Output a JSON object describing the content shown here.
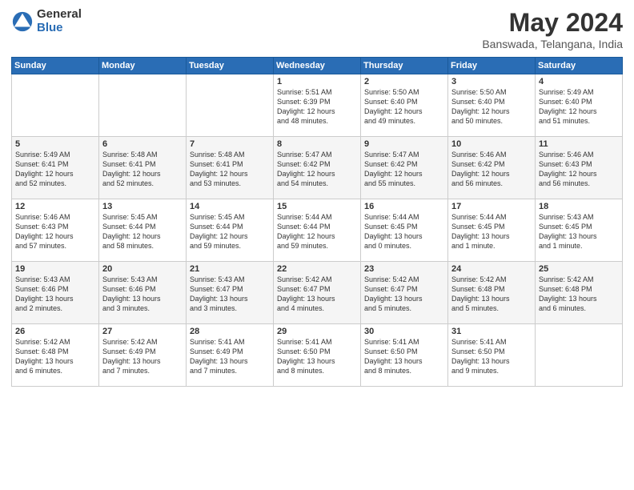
{
  "logo": {
    "general": "General",
    "blue": "Blue"
  },
  "title": {
    "month": "May 2024",
    "location": "Banswada, Telangana, India"
  },
  "headers": [
    "Sunday",
    "Monday",
    "Tuesday",
    "Wednesday",
    "Thursday",
    "Friday",
    "Saturday"
  ],
  "weeks": [
    [
      {
        "day": "",
        "info": ""
      },
      {
        "day": "",
        "info": ""
      },
      {
        "day": "",
        "info": ""
      },
      {
        "day": "1",
        "info": "Sunrise: 5:51 AM\nSunset: 6:39 PM\nDaylight: 12 hours\nand 48 minutes."
      },
      {
        "day": "2",
        "info": "Sunrise: 5:50 AM\nSunset: 6:40 PM\nDaylight: 12 hours\nand 49 minutes."
      },
      {
        "day": "3",
        "info": "Sunrise: 5:50 AM\nSunset: 6:40 PM\nDaylight: 12 hours\nand 50 minutes."
      },
      {
        "day": "4",
        "info": "Sunrise: 5:49 AM\nSunset: 6:40 PM\nDaylight: 12 hours\nand 51 minutes."
      }
    ],
    [
      {
        "day": "5",
        "info": "Sunrise: 5:49 AM\nSunset: 6:41 PM\nDaylight: 12 hours\nand 52 minutes."
      },
      {
        "day": "6",
        "info": "Sunrise: 5:48 AM\nSunset: 6:41 PM\nDaylight: 12 hours\nand 52 minutes."
      },
      {
        "day": "7",
        "info": "Sunrise: 5:48 AM\nSunset: 6:41 PM\nDaylight: 12 hours\nand 53 minutes."
      },
      {
        "day": "8",
        "info": "Sunrise: 5:47 AM\nSunset: 6:42 PM\nDaylight: 12 hours\nand 54 minutes."
      },
      {
        "day": "9",
        "info": "Sunrise: 5:47 AM\nSunset: 6:42 PM\nDaylight: 12 hours\nand 55 minutes."
      },
      {
        "day": "10",
        "info": "Sunrise: 5:46 AM\nSunset: 6:42 PM\nDaylight: 12 hours\nand 56 minutes."
      },
      {
        "day": "11",
        "info": "Sunrise: 5:46 AM\nSunset: 6:43 PM\nDaylight: 12 hours\nand 56 minutes."
      }
    ],
    [
      {
        "day": "12",
        "info": "Sunrise: 5:46 AM\nSunset: 6:43 PM\nDaylight: 12 hours\nand 57 minutes."
      },
      {
        "day": "13",
        "info": "Sunrise: 5:45 AM\nSunset: 6:44 PM\nDaylight: 12 hours\nand 58 minutes."
      },
      {
        "day": "14",
        "info": "Sunrise: 5:45 AM\nSunset: 6:44 PM\nDaylight: 12 hours\nand 59 minutes."
      },
      {
        "day": "15",
        "info": "Sunrise: 5:44 AM\nSunset: 6:44 PM\nDaylight: 12 hours\nand 59 minutes."
      },
      {
        "day": "16",
        "info": "Sunrise: 5:44 AM\nSunset: 6:45 PM\nDaylight: 13 hours\nand 0 minutes."
      },
      {
        "day": "17",
        "info": "Sunrise: 5:44 AM\nSunset: 6:45 PM\nDaylight: 13 hours\nand 1 minute."
      },
      {
        "day": "18",
        "info": "Sunrise: 5:43 AM\nSunset: 6:45 PM\nDaylight: 13 hours\nand 1 minute."
      }
    ],
    [
      {
        "day": "19",
        "info": "Sunrise: 5:43 AM\nSunset: 6:46 PM\nDaylight: 13 hours\nand 2 minutes."
      },
      {
        "day": "20",
        "info": "Sunrise: 5:43 AM\nSunset: 6:46 PM\nDaylight: 13 hours\nand 3 minutes."
      },
      {
        "day": "21",
        "info": "Sunrise: 5:43 AM\nSunset: 6:47 PM\nDaylight: 13 hours\nand 3 minutes."
      },
      {
        "day": "22",
        "info": "Sunrise: 5:42 AM\nSunset: 6:47 PM\nDaylight: 13 hours\nand 4 minutes."
      },
      {
        "day": "23",
        "info": "Sunrise: 5:42 AM\nSunset: 6:47 PM\nDaylight: 13 hours\nand 5 minutes."
      },
      {
        "day": "24",
        "info": "Sunrise: 5:42 AM\nSunset: 6:48 PM\nDaylight: 13 hours\nand 5 minutes."
      },
      {
        "day": "25",
        "info": "Sunrise: 5:42 AM\nSunset: 6:48 PM\nDaylight: 13 hours\nand 6 minutes."
      }
    ],
    [
      {
        "day": "26",
        "info": "Sunrise: 5:42 AM\nSunset: 6:48 PM\nDaylight: 13 hours\nand 6 minutes."
      },
      {
        "day": "27",
        "info": "Sunrise: 5:42 AM\nSunset: 6:49 PM\nDaylight: 13 hours\nand 7 minutes."
      },
      {
        "day": "28",
        "info": "Sunrise: 5:41 AM\nSunset: 6:49 PM\nDaylight: 13 hours\nand 7 minutes."
      },
      {
        "day": "29",
        "info": "Sunrise: 5:41 AM\nSunset: 6:50 PM\nDaylight: 13 hours\nand 8 minutes."
      },
      {
        "day": "30",
        "info": "Sunrise: 5:41 AM\nSunset: 6:50 PM\nDaylight: 13 hours\nand 8 minutes."
      },
      {
        "day": "31",
        "info": "Sunrise: 5:41 AM\nSunset: 6:50 PM\nDaylight: 13 hours\nand 9 minutes."
      },
      {
        "day": "",
        "info": ""
      }
    ]
  ]
}
